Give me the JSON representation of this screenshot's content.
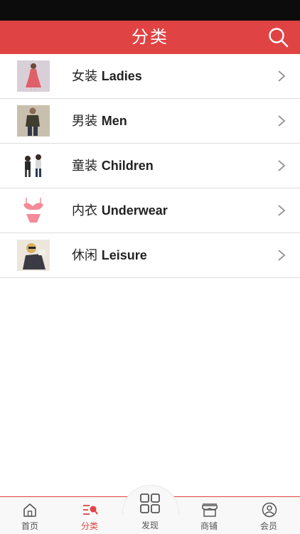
{
  "header": {
    "title": "分类"
  },
  "categories": [
    {
      "cn": "女装",
      "en": "Ladies",
      "image": "red-dress-model"
    },
    {
      "cn": "男装",
      "en": "Men",
      "image": "men-jacket-model"
    },
    {
      "cn": "童装",
      "en": "Children",
      "image": "children-models"
    },
    {
      "cn": "内衣",
      "en": "Underwear",
      "image": "pink-lingerie"
    },
    {
      "cn": "休闲",
      "en": "Leisure",
      "image": "leisure-woman"
    }
  ],
  "tabbar": {
    "home": "首页",
    "category": "分类",
    "discover": "发现",
    "shop": "商铺",
    "member": "会员"
  },
  "colors": {
    "accent": "#e04343"
  }
}
